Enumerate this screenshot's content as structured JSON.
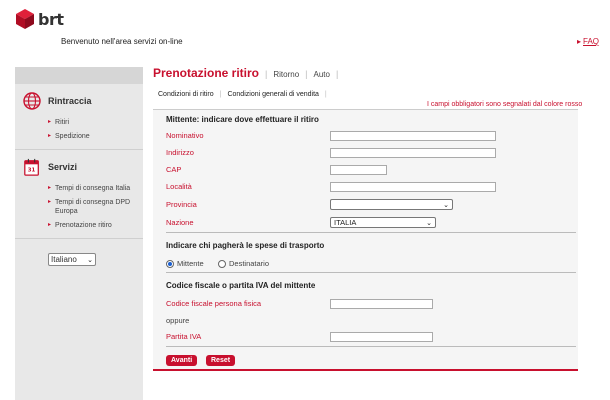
{
  "brand": {
    "name": "brt",
    "color": "#c8102e"
  },
  "header": {
    "welcome": "Benvenuto  nell'area servizi on-line",
    "faq": "FAQ"
  },
  "sidebar": {
    "sections": [
      {
        "title": "Rintraccia",
        "icon": "globe-icon",
        "items": [
          "Ritiri",
          "Spedizione"
        ]
      },
      {
        "title": "Servizi",
        "icon": "calendar-icon",
        "items": [
          "Tempi di consegna Italia",
          "Tempi di consegna DPD Europa",
          "Prenotazione ritiro"
        ]
      }
    ],
    "language": "Italiano"
  },
  "main": {
    "title": "Prenotazione ritiro",
    "links": [
      "Ritorno",
      "Auto"
    ],
    "subnav": [
      "Condizioni di ritiro",
      "Condizioni generali di vendita"
    ],
    "required_note": "I campi obbligatori sono segnalati dal colore rosso",
    "section1": {
      "title": "Mittente: indicare dove effettuare il ritiro",
      "fields": [
        "Nominativo",
        "Indirizzo",
        "CAP",
        "Località",
        "Provincia",
        "Nazione"
      ],
      "nazione_value": "ITALIA",
      "provincia_value": ""
    },
    "section2": {
      "title": "Indicare chi pagherà le spese di trasporto",
      "options": [
        "Mittente",
        "Destinatario"
      ]
    },
    "section3": {
      "title": "Codice fiscale o partita IVA del mittente",
      "cf_label": "Codice fiscale persona fisica",
      "oppure": "oppure",
      "piva_label": "Partita IVA"
    },
    "buttons": {
      "avanti": "Avanti",
      "reset": "Reset"
    }
  }
}
